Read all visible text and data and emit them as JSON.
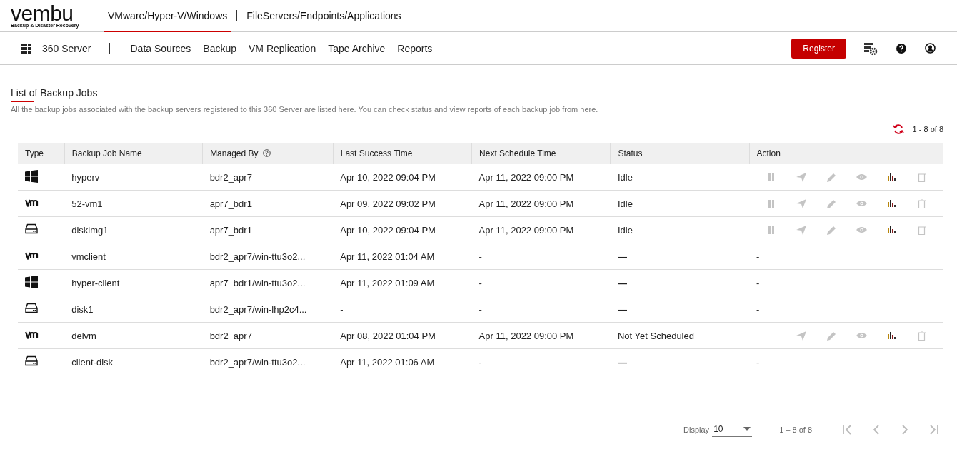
{
  "logo": {
    "name": "vembu",
    "tagline": "Backup & Disaster Recovery"
  },
  "top_tabs": [
    {
      "label": "VMware/Hyper-V/Windows",
      "selected": true
    },
    {
      "label": "FileServers/Endpoints/Applications",
      "selected": false
    }
  ],
  "nav": {
    "product": "360 Server",
    "items": [
      "Data Sources",
      "Backup",
      "VM Replication",
      "Tape Archive",
      "Reports"
    ],
    "register": "Register"
  },
  "page": {
    "title": "List of Backup Jobs",
    "description": "All the backup jobs associated with the backup servers registered to this 360 Server are listed here. You can check status and view reports of each backup job from here.",
    "count": "1 - 8 of 8"
  },
  "table": {
    "columns": [
      "Type",
      "Backup Job Name",
      "Managed By",
      "Last Success Time",
      "Next Schedule Time",
      "Status",
      "Action"
    ],
    "rows": [
      {
        "kind": "windows",
        "name": "hyperv",
        "managed_by": "bdr2_apr7",
        "last_success": "Apr 10, 2022 09:04 PM",
        "next_schedule": "Apr 11, 2022 09:00 PM",
        "status": "Idle",
        "actions": [
          {
            "kind": "pause"
          },
          {
            "kind": "send"
          },
          {
            "kind": "edit"
          },
          {
            "kind": "view"
          },
          {
            "kind": "report"
          },
          {
            "kind": "delete"
          }
        ]
      },
      {
        "kind": "vmware",
        "name": "52-vm1",
        "managed_by": "apr7_bdr1",
        "last_success": "Apr 09, 2022 09:02 PM",
        "next_schedule": "Apr 11, 2022 09:00 PM",
        "status": "Idle",
        "actions": [
          {
            "kind": "pause"
          },
          {
            "kind": "send"
          },
          {
            "kind": "edit"
          },
          {
            "kind": "view"
          },
          {
            "kind": "report"
          },
          {
            "kind": "delete"
          }
        ]
      },
      {
        "kind": "disk",
        "name": "diskimg1",
        "managed_by": "apr7_bdr1",
        "last_success": "Apr 10, 2022 09:04 PM",
        "next_schedule": "Apr 11, 2022 09:00 PM",
        "status": "Idle",
        "actions": [
          {
            "kind": "pause"
          },
          {
            "kind": "send"
          },
          {
            "kind": "edit"
          },
          {
            "kind": "view"
          },
          {
            "kind": "report"
          },
          {
            "kind": "delete"
          }
        ]
      },
      {
        "kind": "vmware",
        "name": "vmclient",
        "managed_by": "bdr2_apr7/win-ttu3o2...",
        "last_success": "Apr 11, 2022 01:04 AM",
        "next_schedule": "-",
        "status": "—",
        "action_text": "-"
      },
      {
        "kind": "windows",
        "name": "hyper-client",
        "managed_by": "apr7_bdr1/win-ttu3o2...",
        "last_success": "Apr 11, 2022 01:09 AM",
        "next_schedule": "-",
        "status": "—",
        "action_text": "-"
      },
      {
        "kind": "disk",
        "name": "disk1",
        "managed_by": "bdr2_apr7/win-lhp2c4...",
        "last_success": "-",
        "next_schedule": "-",
        "status": "—",
        "action_text": "-"
      },
      {
        "kind": "vmware",
        "name": "delvm",
        "managed_by": "bdr2_apr7",
        "last_success": "Apr 08, 2022 01:04 PM",
        "next_schedule": "Apr 11, 2022 09:00 PM",
        "status": "Not Yet Scheduled",
        "actions": [
          {
            "kind": "send"
          },
          {
            "kind": "edit"
          },
          {
            "kind": "view"
          },
          {
            "kind": "report"
          },
          {
            "kind": "delete"
          }
        ]
      },
      {
        "kind": "disk",
        "name": "client-disk",
        "managed_by": "bdr2_apr7/win-ttu3o2...",
        "last_success": "Apr 11, 2022 01:06 AM",
        "next_schedule": "-",
        "status": "—",
        "action_text": "-"
      }
    ]
  },
  "pagination": {
    "display_label": "Display",
    "page_size": "10",
    "range": "1 – 8 of 8"
  }
}
